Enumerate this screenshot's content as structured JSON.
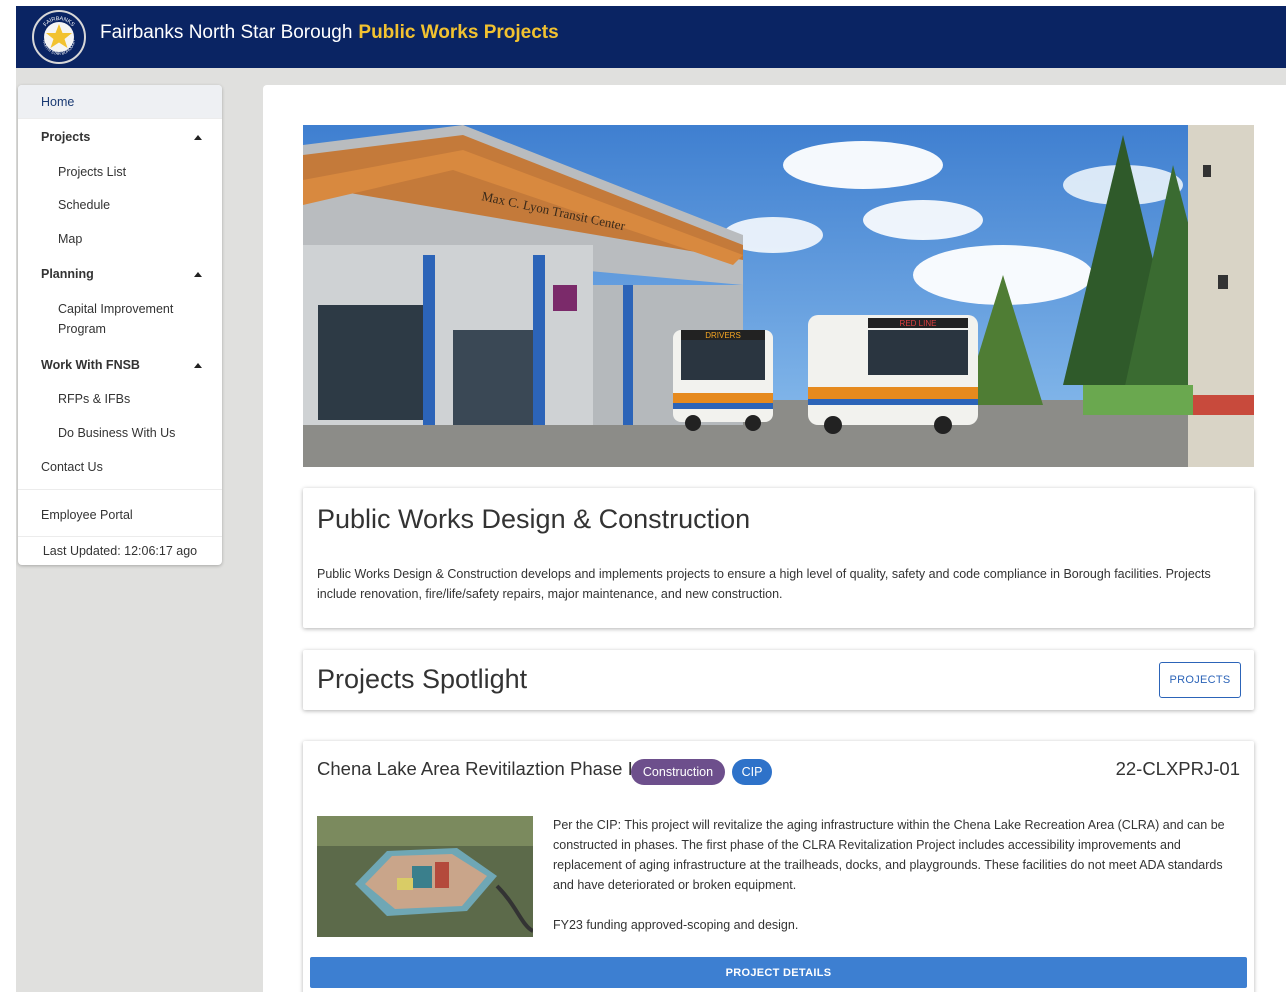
{
  "header": {
    "org_name": "Fairbanks North Star Borough",
    "app_name": "Public Works Projects",
    "logo_text_top": "FAIRBANKS",
    "logo_text_bottom": "NORTH STAR BOROUGH"
  },
  "sidebar": {
    "home": "Home",
    "projects": {
      "label": "Projects",
      "items": [
        "Projects List",
        "Schedule",
        "Map"
      ]
    },
    "planning": {
      "label": "Planning",
      "items": [
        "Capital Improvement",
        "Program"
      ]
    },
    "work": {
      "label": "Work With FNSB",
      "items": [
        "RFPs & IFBs",
        "Do Business With Us"
      ]
    },
    "contact": "Contact Us",
    "employee_portal": "Employee Portal",
    "last_updated": "Last Updated: 12:06:17 ago"
  },
  "hero": {
    "sign_text": "Max C. Lyon Transit Center",
    "bus1_sign": "DRIVERS",
    "bus2_sign": "RED LINE"
  },
  "intro": {
    "title": "Public Works Design & Construction",
    "body": "Public Works Design & Construction develops and implements projects to ensure a high level of quality, safety and code compliance in Borough facilities. Projects include renovation, fire/life/safety repairs, major maintenance, and new construction."
  },
  "spotlight": {
    "title": "Projects Spotlight",
    "button_label": "PROJECTS"
  },
  "project": {
    "title": "Chena Lake Area Revitilaztion Phase I",
    "chips": [
      "Construction",
      "CIP"
    ],
    "id": "22-CLXPRJ-01",
    "description": "Per the CIP: This project will revitalize the aging infrastructure within the Chena Lake Recreation Area (CLRA) and can be constructed in phases. The first phase of the CLRA Revitalization Project includes accessibility improvements and replacement of aging infrastructure at the trailheads, docks, and playgrounds. These facilities do not meet ADA standards and have deteriorated or broken equipment.",
    "funding": "FY23 funding approved-scoping and design.",
    "button_label": "PROJECT DETAILS"
  },
  "colors": {
    "header_bg": "#0a2463",
    "app_name": "#f2c230",
    "accent": "#2c64b8",
    "chip_construction": "#6d4f8c",
    "chip_cip": "#2e72c9"
  }
}
